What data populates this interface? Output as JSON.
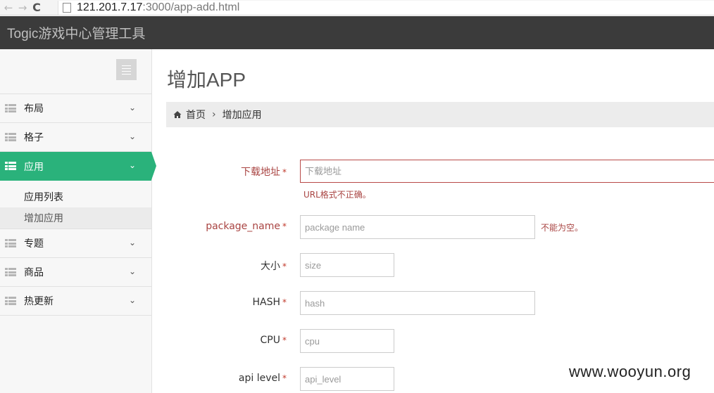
{
  "browser": {
    "url_host": "121.201.7.17",
    "url_path": ":3000/app-add.html",
    "back_glyph": "←",
    "forward_glyph": "→",
    "reload_glyph": "C"
  },
  "navbar": {
    "brand": "Togic游戏中心管理工具"
  },
  "sidebar": {
    "items": [
      {
        "label": "布局"
      },
      {
        "label": "格子"
      },
      {
        "label": "应用",
        "active": true
      },
      {
        "label": "专题"
      },
      {
        "label": "商品"
      },
      {
        "label": "热更新"
      }
    ],
    "submenu": [
      {
        "label": "应用列表"
      },
      {
        "label": "增加应用",
        "current": true
      }
    ],
    "chevron": "⌄"
  },
  "main": {
    "title": "增加APP",
    "breadcrumb": {
      "home": "首页",
      "separator": "›",
      "current": "增加应用"
    }
  },
  "form": {
    "required_mark": "*",
    "download_url": {
      "label": "下载地址",
      "placeholder": "下载地址",
      "error": "URL格式不正确。"
    },
    "package_name": {
      "label": "package_name",
      "placeholder": "package name",
      "error": "不能为空。"
    },
    "size": {
      "label": "大小",
      "placeholder": "size"
    },
    "hash": {
      "label": "HASH",
      "placeholder": "hash"
    },
    "cpu": {
      "label": "CPU",
      "placeholder": "cpu"
    },
    "api_level": {
      "label": "api level",
      "placeholder": "api_level"
    }
  },
  "watermark": "www.wooyun.org",
  "colors": {
    "accent": "#2ab27b",
    "error": "#a94442",
    "navbar": "#3b3b3b"
  }
}
